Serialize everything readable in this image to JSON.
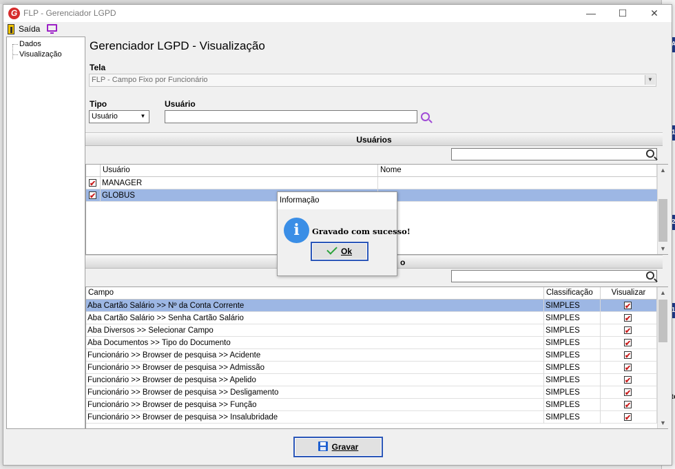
{
  "window": {
    "title": "FLP - Gerenciador LGPD",
    "logo_letter": "G",
    "minimize": "—",
    "maximize": "☐",
    "close": "✕"
  },
  "toolbar": {
    "exit_label": "Saída"
  },
  "tree": {
    "items": [
      {
        "label": "Dados"
      },
      {
        "label": "Visualização"
      }
    ]
  },
  "page": {
    "title": "Gerenciador LGPD - Visualização"
  },
  "tela": {
    "label": "Tela",
    "value": "FLP - Campo Fixo por Funcionário"
  },
  "tipo": {
    "label": "Tipo",
    "value": "Usuário"
  },
  "usuario": {
    "label": "Usuário",
    "value": ""
  },
  "users_section": {
    "title": "Usuários",
    "search_value": "",
    "columns": [
      "Usuário",
      "Nome"
    ],
    "rows": [
      {
        "checked": true,
        "usuario": "MANAGER",
        "nome": "",
        "selected": false
      },
      {
        "checked": true,
        "usuario": "GLOBUS",
        "nome": "",
        "selected": true
      }
    ]
  },
  "fields_section": {
    "title_fragment": "o",
    "search_value": "",
    "columns": [
      "Campo",
      "Classificação",
      "Visualizar"
    ],
    "rows": [
      {
        "campo": "Aba Cartão Salário >> Nº da Conta Corrente",
        "classificacao": "SIMPLES",
        "visualizar": true,
        "selected": true
      },
      {
        "campo": "Aba Cartão Salário >> Senha Cartão Salário",
        "classificacao": "SIMPLES",
        "visualizar": true,
        "selected": false
      },
      {
        "campo": "Aba Diversos >> Selecionar Campo",
        "classificacao": "SIMPLES",
        "visualizar": true,
        "selected": false
      },
      {
        "campo": "Aba Documentos >> Tipo do Documento",
        "classificacao": "SIMPLES",
        "visualizar": true,
        "selected": false
      },
      {
        "campo": "Funcionário >> Browser de pesquisa >> Acidente",
        "classificacao": "SIMPLES",
        "visualizar": true,
        "selected": false
      },
      {
        "campo": "Funcionário >> Browser de pesquisa >> Admissão",
        "classificacao": "SIMPLES",
        "visualizar": true,
        "selected": false
      },
      {
        "campo": "Funcionário >> Browser de pesquisa >> Apelido",
        "classificacao": "SIMPLES",
        "visualizar": true,
        "selected": false
      },
      {
        "campo": "Funcionário >> Browser de pesquisa >> Desligamento",
        "classificacao": "SIMPLES",
        "visualizar": true,
        "selected": false
      },
      {
        "campo": "Funcionário >> Browser de pesquisa >> Função",
        "classificacao": "SIMPLES",
        "visualizar": true,
        "selected": false
      },
      {
        "campo": "Funcionário >> Browser de pesquisa >> Insalubridade",
        "classificacao": "SIMPLES",
        "visualizar": true,
        "selected": false
      }
    ]
  },
  "save_button": {
    "label": "Gravar"
  },
  "dialog": {
    "title": "Informação",
    "icon_glyph": "i",
    "message": "Gravado com sucesso!",
    "ok_label": "Ok"
  },
  "background_fragments": [
    "5A",
    "21",
    "72",
    "11",
    "ato"
  ]
}
